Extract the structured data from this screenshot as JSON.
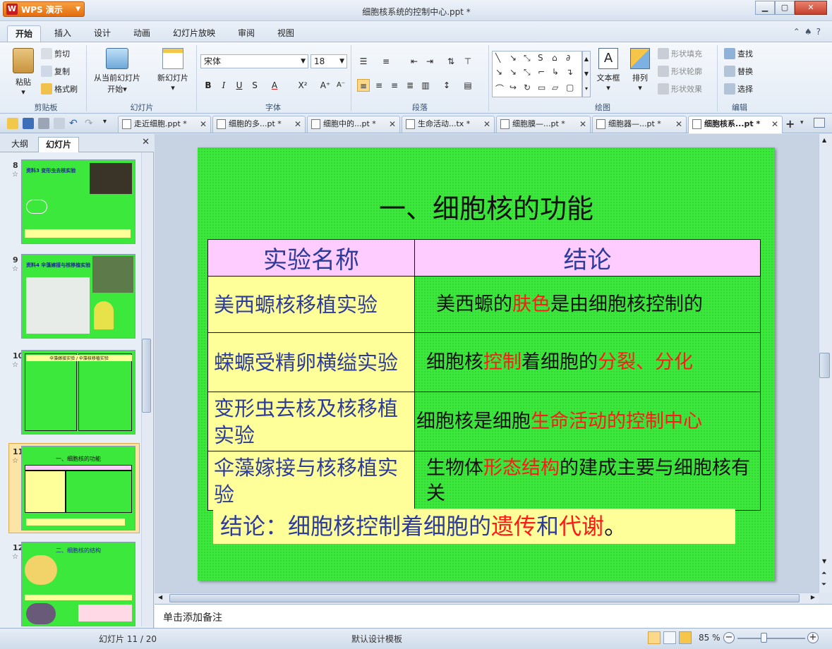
{
  "app": {
    "button_label": "WPS 演示",
    "window_title": "细胞核系统的控制中心.ppt *"
  },
  "menu": {
    "tabs": [
      "开始",
      "插入",
      "设计",
      "动画",
      "幻灯片放映",
      "审阅",
      "视图"
    ]
  },
  "ribbon": {
    "clipboard": {
      "group": "剪贴板",
      "paste": "粘贴",
      "cut": "剪切",
      "copy": "复制",
      "format_painter": "格式刷"
    },
    "slides": {
      "group": "幻灯片",
      "from_current_line1": "从当前幻灯片",
      "from_current_line2": "开始",
      "new_slide": "新幻灯片"
    },
    "font": {
      "group": "字体",
      "font_name": "宋体",
      "font_size": "18"
    },
    "paragraph": {
      "group": "段落"
    },
    "drawing": {
      "group": "绘图",
      "textbox": "文本框",
      "arrange": "排列",
      "shape_fill": "形状填充",
      "shape_outline": "形状轮廓",
      "shape_effect": "形状效果"
    },
    "editing": {
      "group": "编辑",
      "find": "查找",
      "replace": "替换",
      "select": "选择"
    }
  },
  "doc_tabs": [
    "走近细胞.ppt *",
    "细胞的多...pt *",
    "细胞中的...pt *",
    "生命活动...tx *",
    "细胞膜—...pt *",
    "细胞器—...pt *",
    "细胞核系...pt *"
  ],
  "left_panel": {
    "tabs": [
      "大纲",
      "幻灯片"
    ],
    "slides": [
      {
        "number": "8",
        "mini_title": "资料3 变形虫去核实验"
      },
      {
        "number": "9",
        "mini_title": "资料4 伞藻嫁接与核移植实验"
      },
      {
        "number": "10",
        "mini_title": "伞藻嫁接实验 / 伞藻核移植实验"
      },
      {
        "number": "11",
        "mini_title": "一、细胞核的功能"
      },
      {
        "number": "12",
        "mini_title": "二、细胞核的结构"
      }
    ]
  },
  "slide": {
    "title": "一、细胞核的功能",
    "table": {
      "headers": [
        "实验名称",
        "结论"
      ],
      "rows": [
        {
          "name": "美西螈核移植实验",
          "c_pre": "美西螈的",
          "c_red": "肤色",
          "c_post": "是由细胞核控制的",
          "c_red2": "",
          "c_post2": ""
        },
        {
          "name": "蝾螈受精卵横缢实验",
          "c_pre": "细胞核",
          "c_red": "控制",
          "c_post": "着细胞的",
          "c_red2": "分裂、分化",
          "c_post2": ""
        },
        {
          "name": "变形虫去核及核移植实验",
          "c_pre": "细胞核是细胞",
          "c_red": "生命活动的控制中心",
          "c_post": "",
          "c_red2": "",
          "c_post2": ""
        },
        {
          "name": "伞藻嫁接与核移植实验",
          "c_pre": "生物体",
          "c_red": "形态结构",
          "c_post": "的建成主要与细胞核有关",
          "c_red2": "",
          "c_post2": ""
        }
      ]
    },
    "conclusion": {
      "pre": "结论：细胞核控制着细胞的",
      "red1": "遗传",
      "mid": "和",
      "red2": "代谢",
      "post": "。"
    }
  },
  "notes_placeholder": "单击添加备注",
  "status": {
    "slide_info": "幻灯片 11 / 20",
    "template": "默认设计模板",
    "zoom": "85 %"
  }
}
